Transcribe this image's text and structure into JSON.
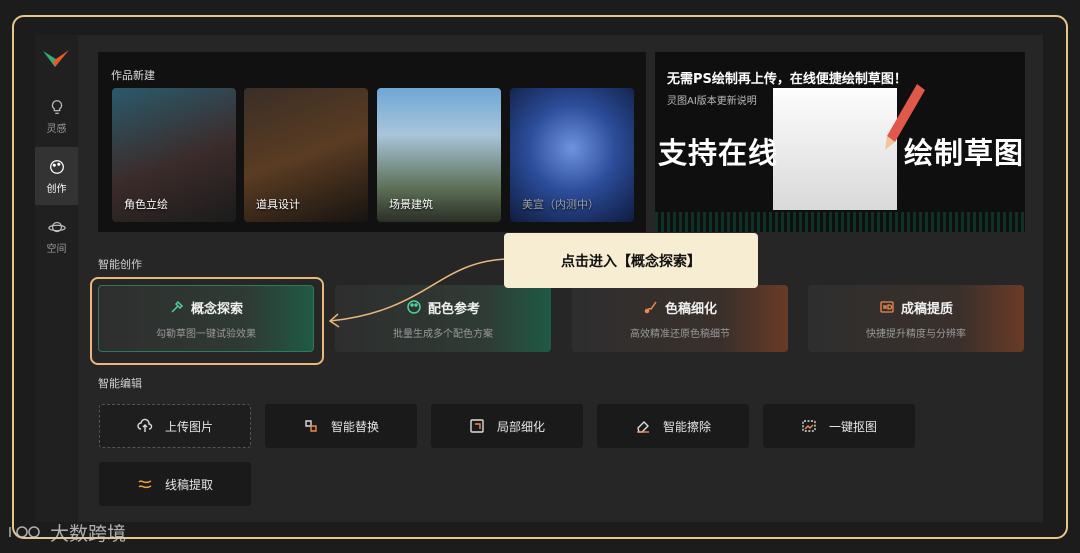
{
  "sidebar": {
    "items": [
      {
        "label": "灵感",
        "icon": "lightbulb-icon"
      },
      {
        "label": "创作",
        "icon": "palette-icon",
        "active": true
      },
      {
        "label": "空间",
        "icon": "planet-icon"
      }
    ]
  },
  "new_work": {
    "title": "作品新建",
    "cards": [
      {
        "label": "角色立绘"
      },
      {
        "label": "道具设计"
      },
      {
        "label": "场景建筑"
      },
      {
        "label": "美宣（内测中）",
        "disabled": true
      }
    ]
  },
  "promo": {
    "headline": "无需PS绘制再上传，在线便捷绘制草图！",
    "sub": "灵图AI版本更新说明",
    "left_text": "支持在线",
    "right_text": "绘制草图"
  },
  "callout": {
    "text": "点击进入【概念探索】"
  },
  "smart_create": {
    "title": "智能创作",
    "cards": [
      {
        "title": "概念探索",
        "desc": "勾勒草图一键试验效果",
        "icon": "concept-icon"
      },
      {
        "title": "配色参考",
        "desc": "批量生成多个配色方案",
        "icon": "palette-icon"
      },
      {
        "title": "色稿细化",
        "desc": "高效精准还原色稿细节",
        "icon": "brush-icon"
      },
      {
        "title": "成稿提质",
        "desc": "快捷提升精度与分辨率",
        "icon": "hd-icon"
      }
    ]
  },
  "smart_edit": {
    "title": "智能编辑",
    "tools": [
      {
        "label": "上传图片",
        "icon": "upload-icon"
      },
      {
        "label": "智能替换",
        "icon": "replace-icon"
      },
      {
        "label": "局部细化",
        "icon": "refine-icon"
      },
      {
        "label": "智能擦除",
        "icon": "eraser-icon"
      },
      {
        "label": "一键抠图",
        "icon": "cutout-icon"
      },
      {
        "label": "线稿提取",
        "icon": "lineart-icon"
      }
    ]
  },
  "watermark": {
    "text": "大数跨境"
  },
  "colors": {
    "accent_green": "#2f7a58",
    "highlight": "#e8b77a",
    "callout_bg": "#f7edd3"
  }
}
